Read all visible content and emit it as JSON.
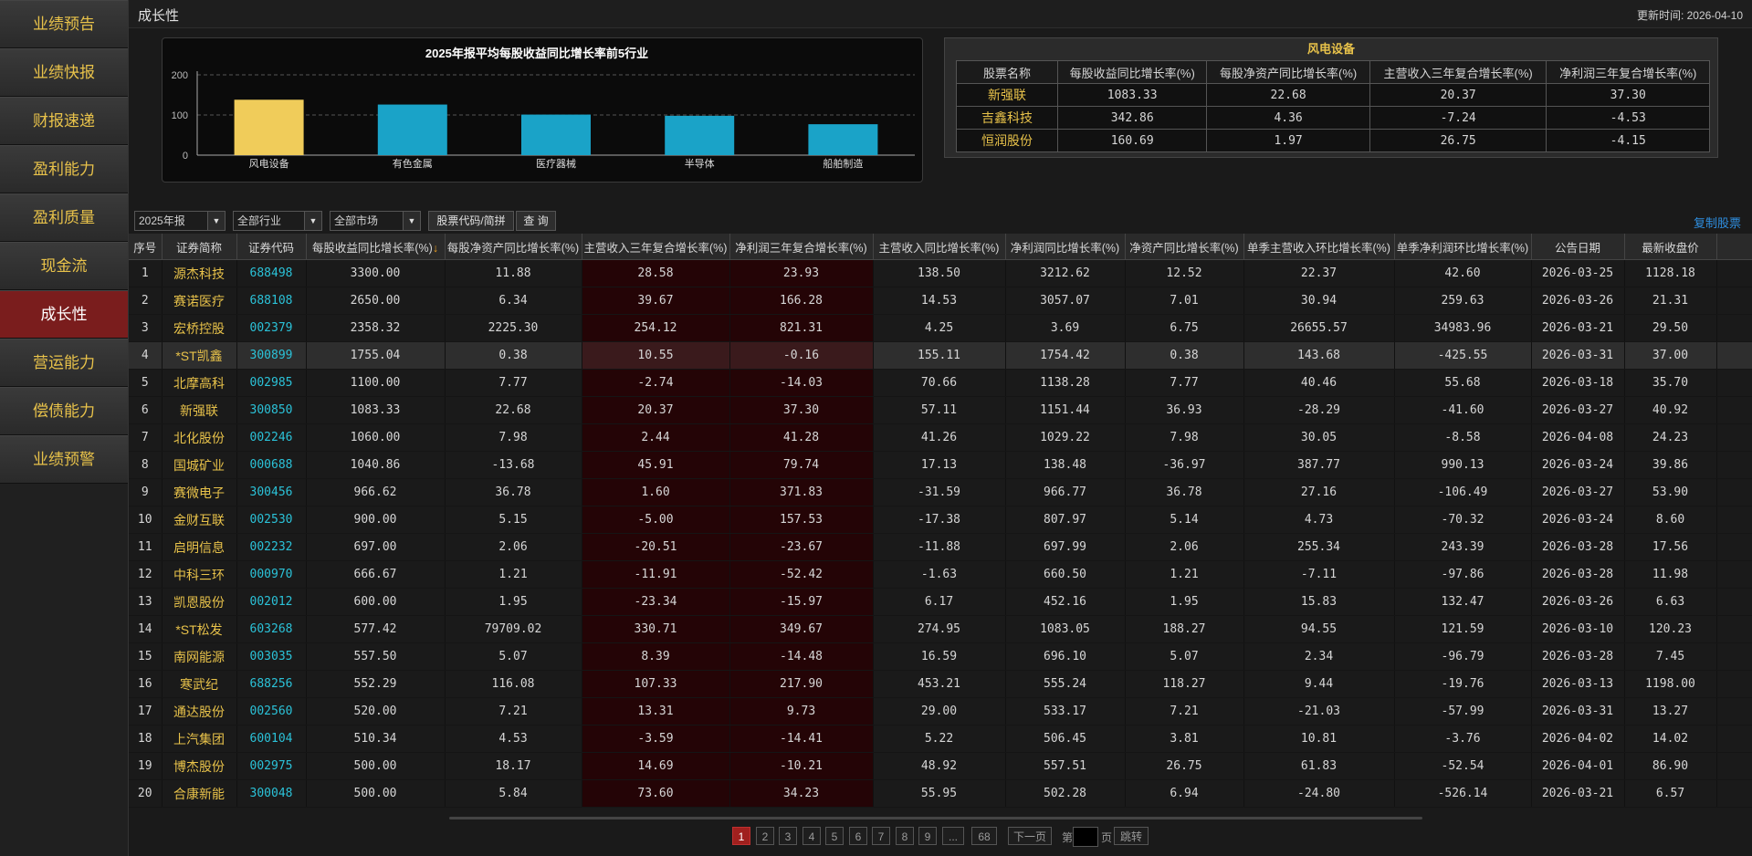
{
  "sidebar": {
    "items": [
      {
        "label": "业绩预告"
      },
      {
        "label": "业绩快报"
      },
      {
        "label": "财报速递"
      },
      {
        "label": "盈利能力"
      },
      {
        "label": "盈利质量"
      },
      {
        "label": "现金流"
      },
      {
        "label": "成长性"
      },
      {
        "label": "营运能力"
      },
      {
        "label": "偿债能力"
      },
      {
        "label": "业绩预警"
      }
    ],
    "active_index": 6
  },
  "header": {
    "title": "成长性",
    "update_time": "更新时间: 2026-04-10"
  },
  "chart_data": {
    "type": "bar",
    "title": "2025年报平均每股收益同比增长率前5行业",
    "categories": [
      "风电设备",
      "有色金属",
      "医疗器械",
      "半导体",
      "船舶制造"
    ],
    "values": [
      138,
      126,
      101,
      98,
      77
    ],
    "colors": [
      "#f0cc5a",
      "#1aa3c8",
      "#1aa3c8",
      "#1aa3c8",
      "#1aa3c8"
    ],
    "ylim": [
      0,
      200
    ],
    "yticks": [
      "0",
      "100",
      "200"
    ],
    "grid": true
  },
  "sector_panel": {
    "title": "风电设备",
    "headers": [
      "股票名称",
      "每股收益同比增长率(%)",
      "每股净资产同比增长率(%)",
      "主营收入三年复合增长率(%)",
      "净利润三年复合增长率(%)"
    ],
    "rows": [
      [
        "新强联",
        "1083.33",
        "22.68",
        "20.37",
        "37.30"
      ],
      [
        "吉鑫科技",
        "342.86",
        "4.36",
        "-7.24",
        "-4.53"
      ],
      [
        "恒润股份",
        "160.69",
        "1.97",
        "26.75",
        "-4.15"
      ]
    ]
  },
  "filters": {
    "period": "2025年报",
    "industry": "全部行业",
    "market": "全部市场",
    "search_label": "股票代码/简拼",
    "query_button": "查 询",
    "copy_link": "复制股票"
  },
  "table": {
    "headers": [
      "序号",
      "证券简称",
      "证券代码",
      "每股收益同比增长率(%)",
      "每股净资产同比增长率(%)",
      "主营收入三年复合增长率(%)",
      "净利润三年复合增长率(%)",
      "主营收入同比增长率(%)",
      "净利润同比增长率(%)",
      "净资产同比增长率(%)",
      "单季主营收入环比增长率(%)",
      "单季净利润环比增长率(%)",
      "公告日期",
      "最新收盘价"
    ],
    "sort_indicator": "↓",
    "selected_row": 3,
    "rows": [
      [
        "1",
        "源杰科技",
        "688498",
        "3300.00",
        "11.88",
        "28.58",
        "23.93",
        "138.50",
        "3212.62",
        "12.52",
        "22.37",
        "42.60",
        "2026-03-25",
        "1128.18"
      ],
      [
        "2",
        "赛诺医疗",
        "688108",
        "2650.00",
        "6.34",
        "39.67",
        "166.28",
        "14.53",
        "3057.07",
        "7.01",
        "30.94",
        "259.63",
        "2026-03-26",
        "21.31"
      ],
      [
        "3",
        "宏桥控股",
        "002379",
        "2358.32",
        "2225.30",
        "254.12",
        "821.31",
        "4.25",
        "3.69",
        "6.75",
        "26655.57",
        "34983.96",
        "2026-03-21",
        "29.50"
      ],
      [
        "4",
        "*ST凯鑫",
        "300899",
        "1755.04",
        "0.38",
        "10.55",
        "-0.16",
        "155.11",
        "1754.42",
        "0.38",
        "143.68",
        "-425.55",
        "2026-03-31",
        "37.00"
      ],
      [
        "5",
        "北摩高科",
        "002985",
        "1100.00",
        "7.77",
        "-2.74",
        "-14.03",
        "70.66",
        "1138.28",
        "7.77",
        "40.46",
        "55.68",
        "2026-03-18",
        "35.70"
      ],
      [
        "6",
        "新强联",
        "300850",
        "1083.33",
        "22.68",
        "20.37",
        "37.30",
        "57.11",
        "1151.44",
        "36.93",
        "-28.29",
        "-41.60",
        "2026-03-27",
        "40.92"
      ],
      [
        "7",
        "北化股份",
        "002246",
        "1060.00",
        "7.98",
        "2.44",
        "41.28",
        "41.26",
        "1029.22",
        "7.98",
        "30.05",
        "-8.58",
        "2026-04-08",
        "24.23"
      ],
      [
        "8",
        "国城矿业",
        "000688",
        "1040.86",
        "-13.68",
        "45.91",
        "79.74",
        "17.13",
        "138.48",
        "-36.97",
        "387.77",
        "990.13",
        "2026-03-24",
        "39.86"
      ],
      [
        "9",
        "赛微电子",
        "300456",
        "966.62",
        "36.78",
        "1.60",
        "371.83",
        "-31.59",
        "966.77",
        "36.78",
        "27.16",
        "-106.49",
        "2026-03-27",
        "53.90"
      ],
      [
        "10",
        "金财互联",
        "002530",
        "900.00",
        "5.15",
        "-5.00",
        "157.53",
        "-17.38",
        "807.97",
        "5.14",
        "4.73",
        "-70.32",
        "2026-03-24",
        "8.60"
      ],
      [
        "11",
        "启明信息",
        "002232",
        "697.00",
        "2.06",
        "-20.51",
        "-23.67",
        "-11.88",
        "697.99",
        "2.06",
        "255.34",
        "243.39",
        "2026-03-28",
        "17.56"
      ],
      [
        "12",
        "中科三环",
        "000970",
        "666.67",
        "1.21",
        "-11.91",
        "-52.42",
        "-1.63",
        "660.50",
        "1.21",
        "-7.11",
        "-97.86",
        "2026-03-28",
        "11.98"
      ],
      [
        "13",
        "凯恩股份",
        "002012",
        "600.00",
        "1.95",
        "-23.34",
        "-15.97",
        "6.17",
        "452.16",
        "1.95",
        "15.83",
        "132.47",
        "2026-03-26",
        "6.63"
      ],
      [
        "14",
        "*ST松发",
        "603268",
        "577.42",
        "79709.02",
        "330.71",
        "349.67",
        "274.95",
        "1083.05",
        "188.27",
        "94.55",
        "121.59",
        "2026-03-10",
        "120.23"
      ],
      [
        "15",
        "南网能源",
        "003035",
        "557.50",
        "5.07",
        "8.39",
        "-14.48",
        "16.59",
        "696.10",
        "5.07",
        "2.34",
        "-96.79",
        "2026-03-28",
        "7.45"
      ],
      [
        "16",
        "寒武纪",
        "688256",
        "552.29",
        "116.08",
        "107.33",
        "217.90",
        "453.21",
        "555.24",
        "118.27",
        "9.44",
        "-19.76",
        "2026-03-13",
        "1198.00"
      ],
      [
        "17",
        "通达股份",
        "002560",
        "520.00",
        "7.21",
        "13.31",
        "9.73",
        "29.00",
        "533.17",
        "7.21",
        "-21.03",
        "-57.99",
        "2026-03-31",
        "13.27"
      ],
      [
        "18",
        "上汽集团",
        "600104",
        "510.34",
        "4.53",
        "-3.59",
        "-14.41",
        "5.22",
        "506.45",
        "3.81",
        "10.81",
        "-3.76",
        "2026-04-02",
        "14.02"
      ],
      [
        "19",
        "博杰股份",
        "002975",
        "500.00",
        "18.17",
        "14.69",
        "-10.21",
        "48.92",
        "557.51",
        "26.75",
        "61.83",
        "-52.54",
        "2026-04-01",
        "86.90"
      ],
      [
        "20",
        "合康新能",
        "300048",
        "500.00",
        "5.84",
        "73.60",
        "34.23",
        "55.95",
        "502.28",
        "6.94",
        "-24.80",
        "-526.14",
        "2026-03-21",
        "6.57"
      ]
    ]
  },
  "pagination": {
    "current": "1",
    "pages": [
      "1",
      "2",
      "3",
      "4",
      "5",
      "6",
      "7",
      "8",
      "9",
      "...",
      "68"
    ],
    "next": "下一页",
    "goto_prefix": "第",
    "goto_suffix": "页",
    "jump": "跳转"
  }
}
